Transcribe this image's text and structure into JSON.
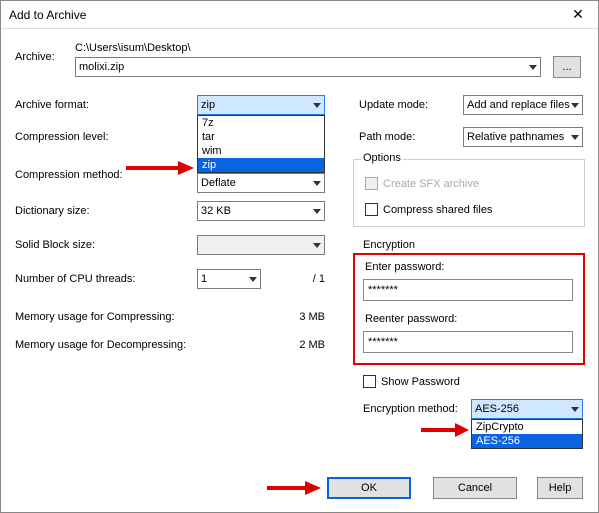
{
  "window": {
    "title": "Add to Archive",
    "close": "✕"
  },
  "archive": {
    "label": "Archive:",
    "path": "C:\\Users\\isum\\Desktop\\",
    "filename": "molixi.zip",
    "browse": "..."
  },
  "left": {
    "format_label": "Archive format:",
    "format_value": "zip",
    "format_options": [
      "7z",
      "tar",
      "wim",
      "zip"
    ],
    "level_label": "Compression level:",
    "method_label": "Compression method:",
    "method_value": "Deflate",
    "dict_label": "Dictionary size:",
    "dict_value": "32 KB",
    "block_label": "Solid Block size:",
    "threads_label": "Number of CPU threads:",
    "threads_value": "1",
    "threads_total": "/ 1",
    "mem_comp_label": "Memory usage for Compressing:",
    "mem_comp_value": "3 MB",
    "mem_decomp_label": "Memory usage for Decompressing:",
    "mem_decomp_value": "2 MB"
  },
  "right": {
    "update_label": "Update mode:",
    "update_value": "Add and replace files",
    "path_label": "Path mode:",
    "path_value": "Relative pathnames",
    "options_label": "Options",
    "sfx_label": "Create SFX archive",
    "compress_shared_label": "Compress shared files",
    "encryption_label": "Encryption",
    "enter_pw_label": "Enter password:",
    "enter_pw_value": "*******",
    "reenter_pw_label": "Reenter password:",
    "reenter_pw_value": "*******",
    "show_pw_label": "Show Password",
    "enc_method_label": "Encryption method:",
    "enc_method_value": "AES-256",
    "enc_method_options": [
      "ZipCrypto",
      "AES-256"
    ]
  },
  "buttons": {
    "ok": "OK",
    "cancel": "Cancel",
    "help": "Help"
  }
}
